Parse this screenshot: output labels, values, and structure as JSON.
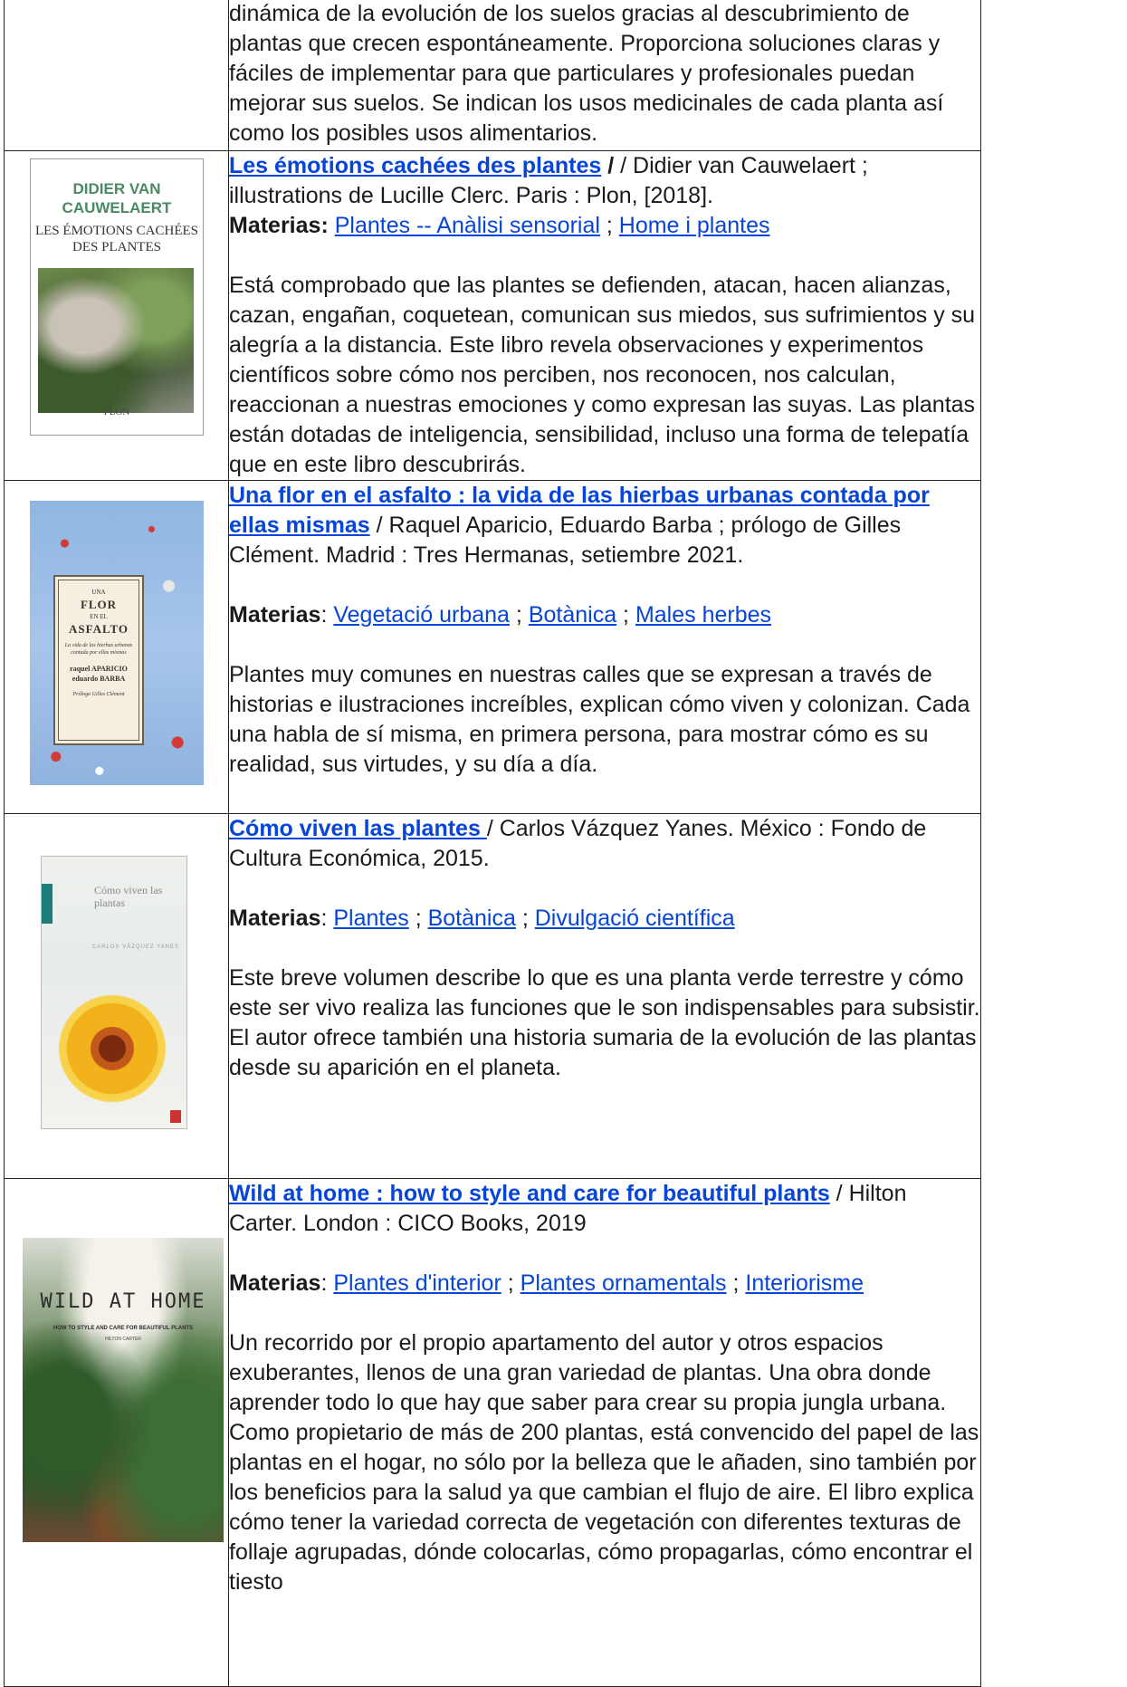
{
  "entries": [
    {
      "description": "dinámica de la evolución de los suelos gracias al descubrimiento de plantas que crecen espontáneamente. Proporciona soluciones claras y fáciles de implementar para que particulares y profesionales puedan mejorar sus suelos. Se indican los usos medicinales de cada planta así como los posibles usos alimentarios."
    },
    {
      "title": "Les émotions cachées des plantes",
      "responsibility": " / Didier van Cauwelaert ; illustrations de Lucille Clerc. Paris : Plon, [2018].",
      "materias_label": "Materias:",
      "subjects": [
        "Plantes -- Anàlisi sensorial",
        "Home i plantes"
      ],
      "description": "Está comprobado que las plantes se defienden, atacan, hacen alianzas, cazan, engañan, coquetean, comunican sus miedos, sus sufrimientos y su alegría a la distancia. Este libro revela observaciones y experimentos científicos sobre cómo nos perciben, nos reconocen, nos calculan, reaccionan a nuestras emociones y como expresan las suyas. Las plantas están dotadas de inteligencia, sensibilidad, incluso una forma de telepatía que en este libro descubrirás.",
      "cover": {
        "author": "DIDIER VAN CAUWELAERT",
        "title": "LES ÉMOTIONS CACHÉES DES PLANTES",
        "publisher": "PLON"
      }
    },
    {
      "title": "Una flor en el asfalto : la vida de las hierbas urbanas contada por ellas mismas",
      "responsibility": " / Raquel Aparicio, Eduardo Barba ; prólogo de Gilles Clément. Madrid : Tres Hermanas, setiembre 2021.",
      "materias_label": "Materias",
      "subjects": [
        "Vegetació urbana",
        "Botànica",
        "Males herbes"
      ],
      "description": "Plantes muy comunes en nuestras calles que se expresan a través de historias e ilustraciones increíbles, explican cómo viven y colonizan. Cada una habla de sí misma, en primera persona, para mostrar cómo es su realidad, sus virtudes, y su día a día.",
      "cover": {
        "small": "UNA",
        "title1": "FLOR",
        "en": "EN EL",
        "title2": "ASFALTO",
        "tagline": "La vida de las hierbas urbanas contada por ellas mismas",
        "author1": "raquel APARICIO",
        "author2": "eduardo BARBA",
        "prologue": "Prólogo Gilles Clément"
      }
    },
    {
      "title": "Cómo viven las plantes ",
      "responsibility": " / Carlos Vázquez Yanes. México : Fondo de Cultura Económica, 2015.",
      "materias_label": "Materias",
      "subjects": [
        "Plantes",
        "Botànica",
        "Divulgació científica"
      ],
      "description": "Este breve volumen describe lo que es una planta verde terrestre y cómo este ser vivo realiza las funciones que le son indispensables para subsistir. El autor ofrece también una historia sumaria de la evolución de las plantas desde su aparición en el planeta.",
      "cover": {
        "title": "Cómo viven las plantas",
        "author": "CARLOS VÁZQUEZ YANES"
      }
    },
    {
      "title": "Wild at home : how to style and care for beautiful plants",
      "responsibility": " / Hilton Carter. London : CICO Books, 2019",
      "materias_label": "Materias",
      "subjects": [
        "Plantes d'interior",
        "Plantes ornamentals",
        "Interiorisme"
      ],
      "description": "Un recorrido por el propio apartamento del autor y otros espacios exuberantes, llenos de una gran variedad de plantas. Una obra donde aprender todo lo que hay que saber para crear su propia jungla urbana. Como propietario de más de 200 plantas, está convencido del papel de las plantas en el hogar, no sólo por la belleza que le añaden, sino también por los beneficios para la salud ya que cambian el flujo de aire. El libro explica cómo tener la variedad correcta de vegetación con diferentes texturas de follaje agrupadas, dónde colocarlas, cómo propagarlas, cómo encontrar el tiesto",
      "cover": {
        "title": "WILD AT HOME",
        "subtitle": "HOW TO STYLE AND CARE FOR BEAUTIFUL PLANTS",
        "author": "HILTON CARTER"
      }
    }
  ],
  "separators": {
    "subject": " ; ",
    "colon": ": "
  },
  "colors": {
    "link": "#0645d8",
    "text": "#1a1a1a",
    "border": "#222222"
  }
}
